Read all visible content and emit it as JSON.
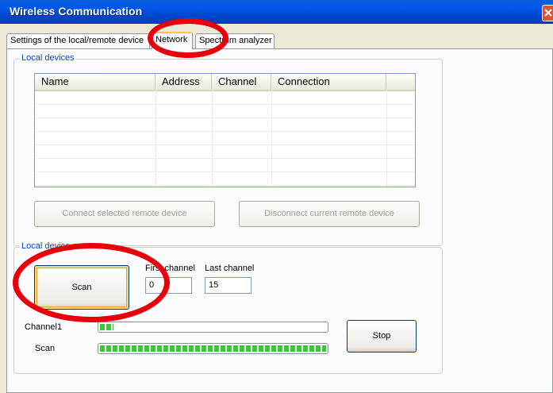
{
  "window": {
    "title": "Wireless Communication"
  },
  "tabs": [
    {
      "label": "Settings of the local/remote device",
      "active": false
    },
    {
      "label": "Network",
      "active": true
    },
    {
      "label": "Spectrum analyzer",
      "active": false
    }
  ],
  "local_devices": {
    "group_label": "Local devices",
    "columns": [
      "Name",
      "Address",
      "Channel",
      "Connection"
    ],
    "rows": [],
    "connect_button": "Connect selected remote device",
    "disconnect_button": "Disconnect current remote device"
  },
  "scan_group": {
    "group_label": "Local device scan",
    "scan_button": "Scan",
    "first_channel_label": "First channel",
    "first_channel_value": "0",
    "last_channel_label": "Last channel",
    "last_channel_value": "15",
    "channel_label": "Channel1",
    "channel_progress": 0.06,
    "scan_label": "Scan",
    "scan_progress": 1.0,
    "stop_button": "Stop"
  },
  "colors": {
    "annotation": "#e8000b",
    "progress": "#37c737",
    "group_label": "#0046d5"
  }
}
